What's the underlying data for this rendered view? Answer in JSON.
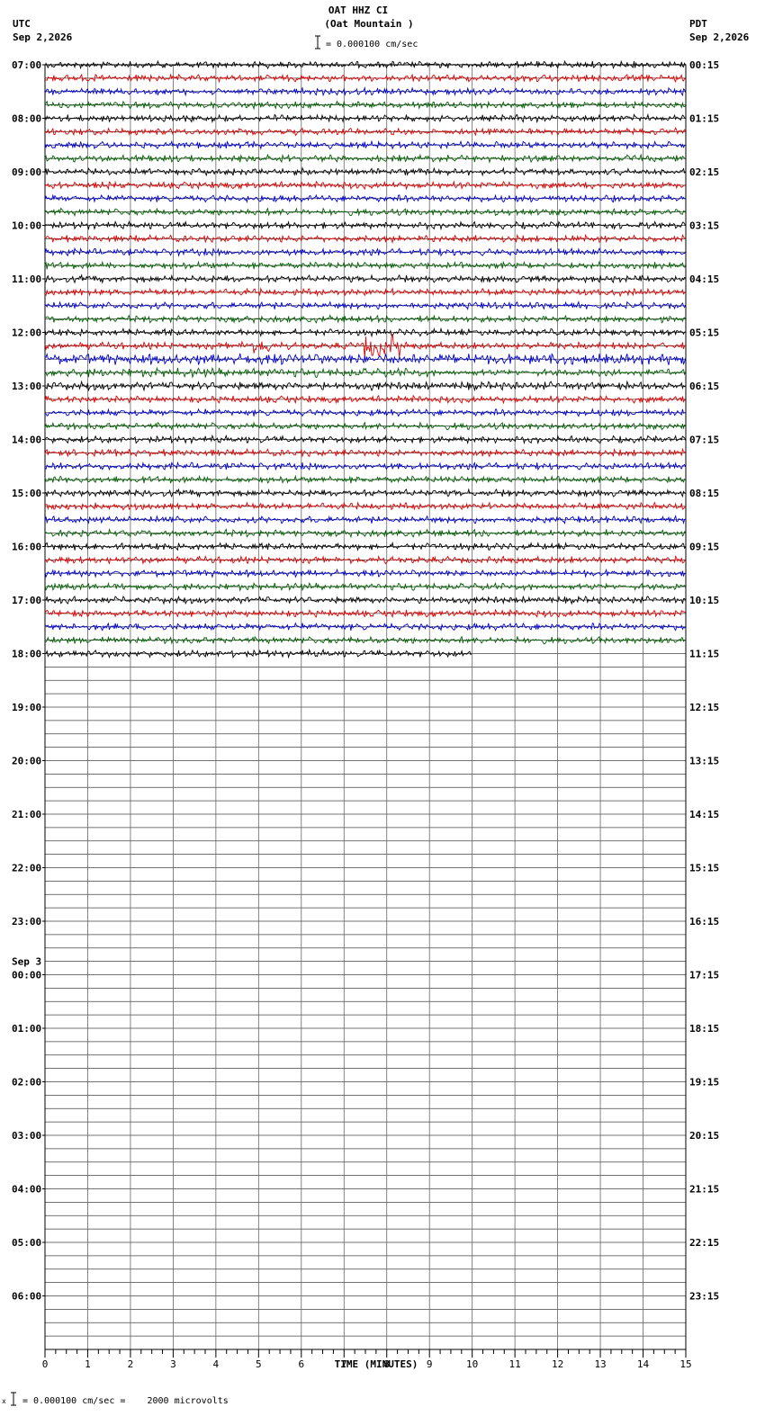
{
  "header": {
    "station": "OAT HHZ CI",
    "location": "(Oat Mountain )",
    "scale_label": "= 0.000100 cm/sec",
    "left_tz": "UTC",
    "left_date": "Sep 2,2026",
    "right_tz": "PDT",
    "right_date": "Sep 2,2026"
  },
  "footer": {
    "scale_note": "= 0.000100 cm/sec =    2000 microvolts"
  },
  "chart_data": {
    "type": "line",
    "title": "OAT HHZ CI (Oat Mountain )",
    "xlabel": "TIME (MINUTES)",
    "ylabel": "",
    "xlim": [
      0,
      15
    ],
    "x_ticks": [
      "0",
      "1",
      "2",
      "3",
      "4",
      "5",
      "6",
      "7",
      "8",
      "9",
      "10",
      "11",
      "12",
      "13",
      "14",
      "15"
    ],
    "trace_colors": [
      "#000000",
      "#e00000",
      "#0000d0",
      "#006000"
    ],
    "grid": true,
    "rows_per_hour": 4,
    "total_rows": 96,
    "filled_rows": 45,
    "last_row_end_minutes": 10,
    "date_change": {
      "label": "Sep 3",
      "hour_index": 17
    },
    "left_hour_labels": [
      "07:00",
      "08:00",
      "09:00",
      "10:00",
      "11:00",
      "12:00",
      "13:00",
      "14:00",
      "15:00",
      "16:00",
      "17:00",
      "18:00",
      "19:00",
      "20:00",
      "21:00",
      "22:00",
      "23:00",
      "00:00",
      "01:00",
      "02:00",
      "03:00",
      "04:00",
      "05:00",
      "06:00"
    ],
    "right_hour_labels": [
      "00:15",
      "01:15",
      "02:15",
      "03:15",
      "04:15",
      "05:15",
      "06:15",
      "07:15",
      "08:15",
      "09:15",
      "10:15",
      "11:15",
      "12:15",
      "13:15",
      "14:15",
      "15:15",
      "16:15",
      "17:15",
      "18:15",
      "19:15",
      "20:15",
      "21:15",
      "22:15",
      "23:15"
    ],
    "events": [
      {
        "row": 21,
        "start_min": 4.6,
        "end_min": 5.3,
        "amplitude": 2.2
      },
      {
        "row": 21,
        "start_min": 7.4,
        "end_min": 8.3,
        "amplitude": 3.5
      },
      {
        "row": 22,
        "start_min": 0.0,
        "end_min": 15.0,
        "amplitude": 1.6
      },
      {
        "row": 23,
        "start_min": 0.0,
        "end_min": 9.0,
        "amplitude": 1.3
      },
      {
        "row": 24,
        "start_min": 0.0,
        "end_min": 15.0,
        "amplitude": 1.2
      }
    ]
  }
}
